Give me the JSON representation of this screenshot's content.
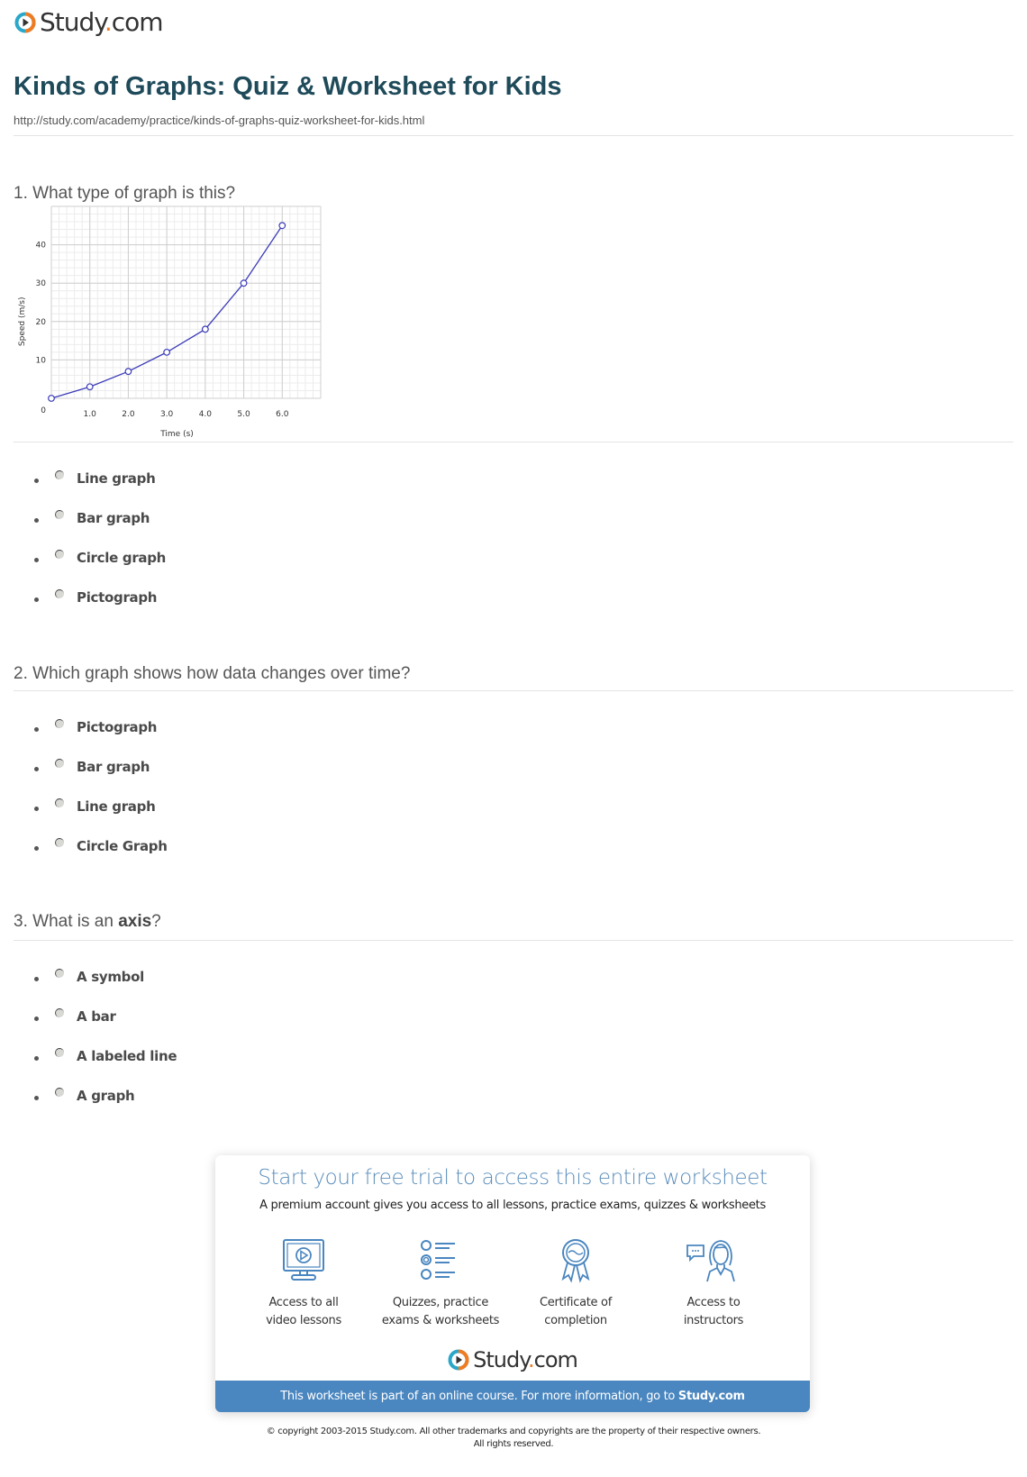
{
  "header": {
    "logo_text_main": "Study",
    "logo_text_dot": ".",
    "logo_text_tail": "com",
    "title": "Kinds of Graphs: Quiz & Worksheet for Kids",
    "url": "http://study.com/academy/practice/kinds-of-graphs-quiz-worksheet-for-kids.html"
  },
  "colors": {
    "title": "#1e4a5a",
    "accent_blue": "#4a86bf",
    "logo_orange": "#f07c22",
    "logo_teal": "#2aa7c9",
    "chart_line": "#3b3bb8"
  },
  "questions": [
    {
      "number": "1.",
      "text": "What type of graph is this?",
      "options": [
        "Line graph",
        "Bar graph",
        "Circle graph",
        "Pictograph"
      ]
    },
    {
      "number": "2.",
      "text": "Which graph shows how data changes over time?",
      "options": [
        "Pictograph",
        "Bar graph",
        "Line graph",
        "Circle Graph"
      ]
    },
    {
      "number": "3.",
      "text_before": "What is an ",
      "text_bold": "axis",
      "text_after": "?",
      "options": [
        "A symbol",
        "A bar",
        "A labeled line",
        "A graph"
      ]
    }
  ],
  "chart_data": {
    "type": "line",
    "title": "",
    "xlabel": "Time (s)",
    "ylabel": "Speed (m/s)",
    "x": [
      0,
      1,
      2,
      3,
      4,
      5,
      6
    ],
    "series": [
      {
        "name": "Speed",
        "values": [
          0,
          3,
          7,
          12,
          18,
          30,
          45
        ]
      }
    ],
    "xlim": [
      0,
      7
    ],
    "ylim": [
      0,
      50
    ],
    "x_ticks": [
      "1.0",
      "2.0",
      "3.0",
      "4.0",
      "5.0",
      "6.0"
    ],
    "y_ticks": [
      "10",
      "20",
      "30",
      "40"
    ],
    "origin_label": "0",
    "grid": true,
    "markers": "open-circle"
  },
  "promo": {
    "title": "Start your free trial to access this entire worksheet",
    "subtitle": "A premium account gives you access to all lessons, practice exams, quizzes & worksheets",
    "features": [
      {
        "icon": "monitor-play-icon",
        "line1": "Access to all",
        "line2": "video lessons"
      },
      {
        "icon": "quiz-list-icon",
        "line1": "Quizzes, practice",
        "line2": "exams & worksheets"
      },
      {
        "icon": "certificate-ribbon-icon",
        "line1": "Certificate of",
        "line2": "completion"
      },
      {
        "icon": "instructor-chat-icon",
        "line1": "Access to",
        "line2": "instructors"
      }
    ],
    "banner_text": "This worksheet is part of an online course. For more information, go to ",
    "banner_link": "Study.com"
  },
  "footer": {
    "copyright_line1": "© copyright 2003-2015 Study.com. All other trademarks and copyrights are the property of their respective owners.",
    "copyright_line2": "All rights reserved."
  }
}
